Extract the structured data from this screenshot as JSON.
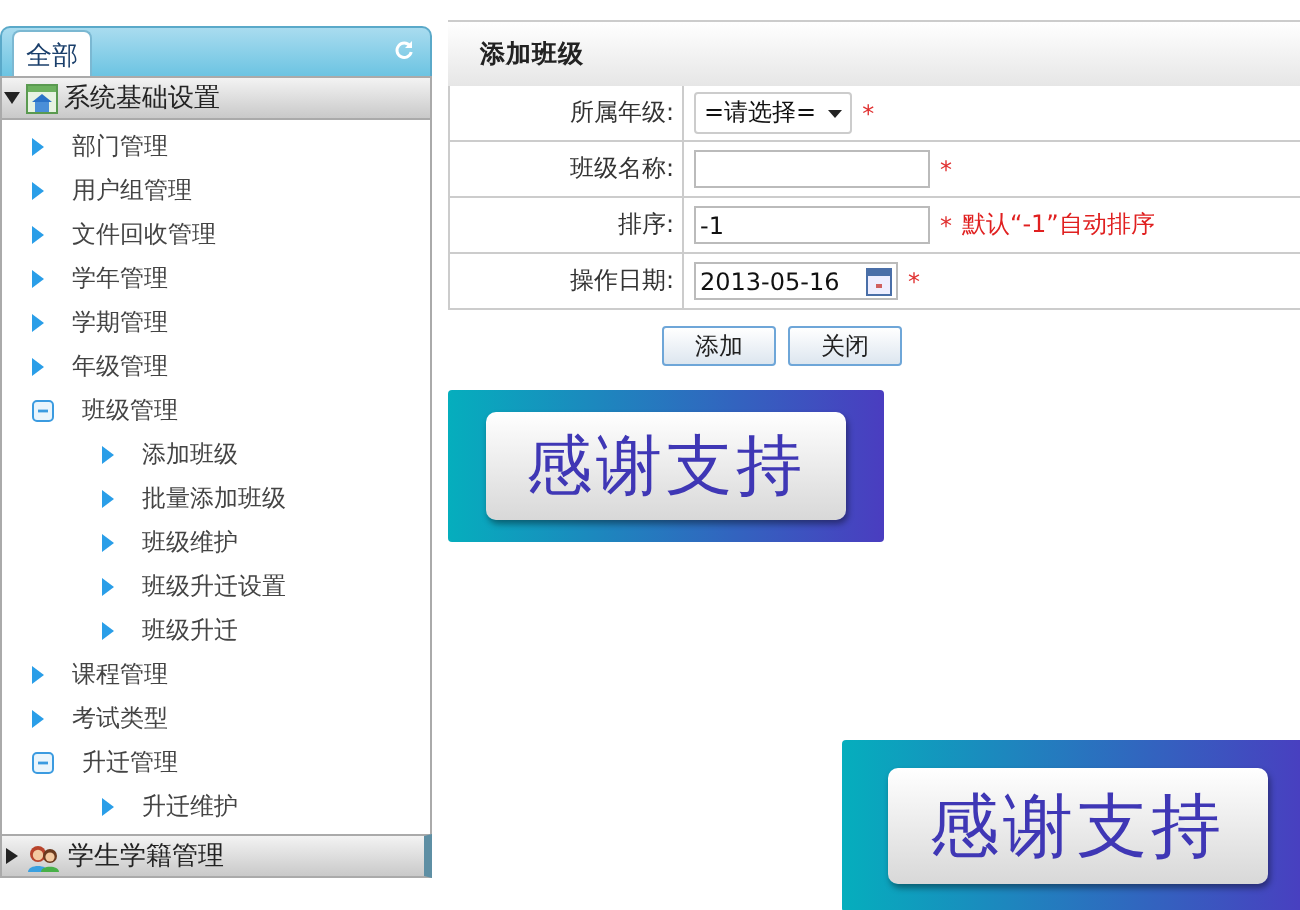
{
  "sidebar": {
    "tabs": [
      {
        "label": "全部",
        "selected": true
      }
    ],
    "groups": [
      {
        "title": "系统基础设置",
        "expanded": true,
        "items": [
          {
            "label": "部门管理"
          },
          {
            "label": "用户组管理"
          },
          {
            "label": "文件回收管理"
          },
          {
            "label": "学年管理"
          },
          {
            "label": "学期管理"
          },
          {
            "label": "年级管理"
          },
          {
            "label": "班级管理",
            "expanded": true,
            "children": [
              {
                "label": "添加班级"
              },
              {
                "label": "批量添加班级"
              },
              {
                "label": "班级维护"
              },
              {
                "label": "班级升迁设置"
              },
              {
                "label": "班级升迁"
              }
            ]
          },
          {
            "label": "课程管理"
          },
          {
            "label": "考试类型"
          },
          {
            "label": "升迁管理",
            "expanded": true,
            "children": [
              {
                "label": "升迁维护"
              }
            ]
          }
        ]
      },
      {
        "title": "学生学籍管理",
        "expanded": false
      }
    ]
  },
  "form": {
    "title": "添加班级",
    "fields": [
      {
        "kind": "select",
        "label": "所属年级:",
        "value": "=请选择=",
        "required": "*"
      },
      {
        "kind": "text",
        "label": "班级名称:",
        "required": "*"
      },
      {
        "kind": "text",
        "label": "排序:",
        "value": "-1",
        "required": "*",
        "hint": "默认“-1”自动排序"
      },
      {
        "kind": "date",
        "label": "操作日期:",
        "value": "2013-05-16",
        "required": "*"
      }
    ],
    "buttons": [
      "添加",
      "关闭"
    ]
  },
  "banners": [
    {
      "text": "感谢支持"
    },
    {
      "text": "感谢支持"
    }
  ]
}
